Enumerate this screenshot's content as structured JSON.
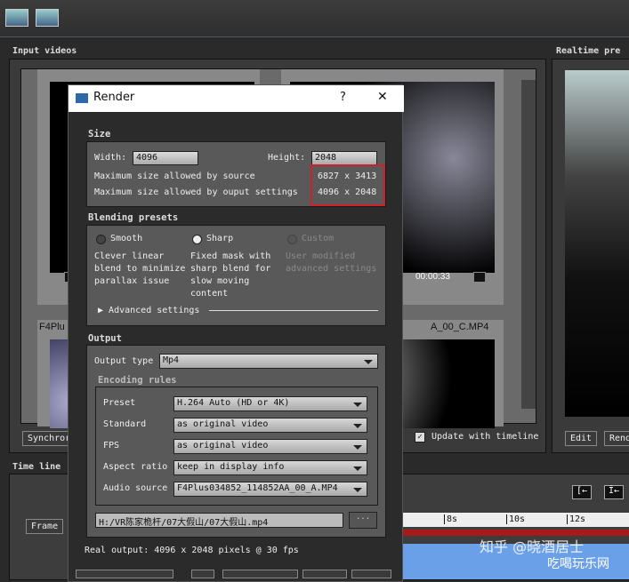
{
  "app": {
    "panels": {
      "input_videos": "Input videos",
      "realtime_preview": "Realtime pre",
      "timeline": "Time line"
    },
    "toolbar": [
      {
        "icon": "video-search-icon"
      },
      {
        "icon": "video-export-icon"
      }
    ],
    "video_labels": [
      "F4Plu",
      "A_00_C.MP4"
    ],
    "time": "00:00:33",
    "synchronize_label": "Synchror",
    "update_with_timeline": {
      "label": "Update with timeline",
      "checked": true
    },
    "edit_label": "Edit",
    "render_label": "Rend",
    "frame_label": "Frame",
    "ticks": [
      "8s",
      "10s",
      "12s"
    ],
    "watermark": "知乎 @晓酒居士",
    "watermark2": "吃喝玩乐网"
  },
  "dialog": {
    "title": "Render",
    "help": "?",
    "close": "✕",
    "size": {
      "label": "Size",
      "width_label": "Width:",
      "width": "4096",
      "height_label": "Height:",
      "height": "2048",
      "max_source_label": "Maximum size allowed by source",
      "max_source": "6827 x 3413",
      "max_output_label": "Maximum size allowed by ouput settings",
      "max_output": "4096 x 2048",
      "highlight_color": "#d0202a"
    },
    "blending": {
      "label": "Blending presets",
      "options": [
        {
          "label": "Smooth",
          "desc": "Clever linear blend to minimize parallax issue",
          "selected": false,
          "enabled": true
        },
        {
          "label": "Sharp",
          "desc": "Fixed mask with sharp blend for slow moving content",
          "selected": true,
          "enabled": true
        },
        {
          "label": "Custom",
          "desc": "User modified advanced settings",
          "selected": false,
          "enabled": false
        }
      ],
      "advanced": "Advanced settings"
    },
    "output": {
      "label": "Output",
      "type_label": "Output type",
      "type": "Mp4",
      "encoding_label": "Encoding rules",
      "rules": [
        {
          "label": "Preset",
          "value": "H.264 Auto (HD or 4K)"
        },
        {
          "label": "Standard",
          "value": "as original video"
        },
        {
          "label": "FPS",
          "value": "as original video"
        },
        {
          "label": "Aspect ratio",
          "value": "keep in display info"
        },
        {
          "label": "Audio source",
          "value": "F4Plus034852_114852AA_00_A.MP4"
        }
      ],
      "path": "H:/VR陈家桅杆/07大假山/07大假山.mp4",
      "browse": "..."
    },
    "real_output": "Real output: 4096 x 2048 pixels @ 30 fps"
  }
}
